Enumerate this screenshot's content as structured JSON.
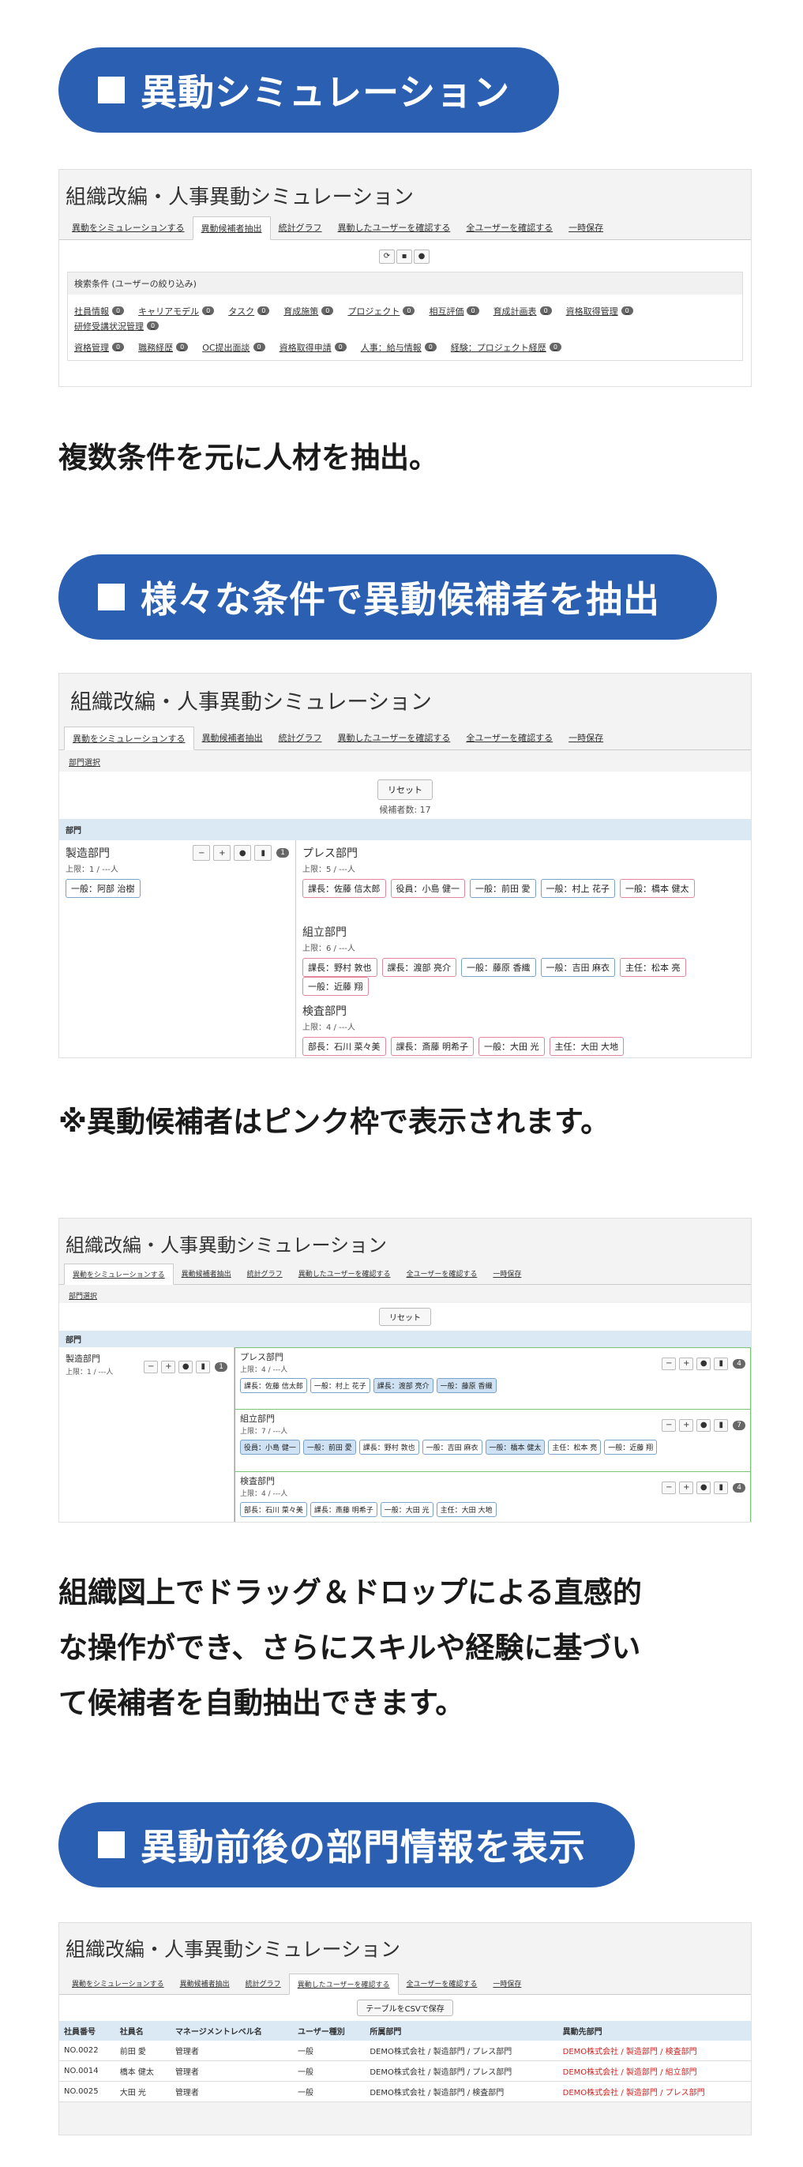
{
  "sections": {
    "s1_heading": "異動シミュレーション",
    "s1_text": "複数条件を元に人材を抽出。",
    "s2_heading": "様々な条件で異動候補者を抽出",
    "s2_text": "※異動候補者はピンク枠で表示されます。",
    "s3_text": [
      "組織図上でドラッグ＆ドロップによる直感的",
      "な操作ができ、さらにスキルや経験に基づい",
      "て候補者を自動抽出できます。"
    ],
    "s4_heading": "異動前後の部門情報を表示"
  },
  "app": {
    "title": "組織改編・人事異動シミュレーション",
    "tabs": [
      "異動をシミュレーションする",
      "異動候補者抽出",
      "統計グラフ",
      "異動したユーザーを確認する",
      "全ユーザーを確認する",
      "一時保存"
    ]
  },
  "shot1": {
    "icons": [
      "refresh-icon",
      "save-icon",
      "user-icon"
    ],
    "filter_title": "検索条件 (ユーザーの絞り込み)",
    "chips_row1": [
      {
        "label": "社員情報",
        "n": "0"
      },
      {
        "label": "キャリアモデル",
        "n": "0"
      },
      {
        "label": "タスク",
        "n": "0"
      },
      {
        "label": "育成施策",
        "n": "0"
      },
      {
        "label": "プロジェクト",
        "n": "0"
      },
      {
        "label": "相互評価",
        "n": "0"
      },
      {
        "label": "育成計画表",
        "n": "0"
      },
      {
        "label": "資格取得管理",
        "n": "0"
      },
      {
        "label": "研修受講状況管理",
        "n": "0"
      }
    ],
    "chips_row2": [
      {
        "label": "資格管理",
        "n": "0"
      },
      {
        "label": "職務経歴",
        "n": "0"
      },
      {
        "label": "OC提出面談",
        "n": "0"
      },
      {
        "label": "資格取得申請",
        "n": "0"
      },
      {
        "label": "人事：給与情報",
        "n": "0"
      },
      {
        "label": "経験：プロジェクト経歴",
        "n": "0"
      }
    ]
  },
  "shot2": {
    "sub_tab": "部門選択",
    "reset": "リセット",
    "candidates": "候補者数: 17",
    "section": "部門",
    "left_dept": {
      "name": "製造部門",
      "cap": "上限：1 / ---人",
      "count": "1",
      "members": [
        {
          "label": "一般：阿部 治樹",
          "pink": false
        }
      ]
    },
    "depts": [
      {
        "name": "プレス部門",
        "cap": "上限：5 / ---人",
        "members": [
          {
            "label": "課長：佐藤 信太郎",
            "pink": true
          },
          {
            "label": "役員：小島 健一",
            "pink": true
          },
          {
            "label": "一般：前田 愛",
            "pink": false
          },
          {
            "label": "一般：村上 花子",
            "pink": false
          },
          {
            "label": "一般：橋本 健太",
            "pink": true
          }
        ]
      },
      {
        "name": "組立部門",
        "cap": "上限：6 / ---人",
        "members": [
          {
            "label": "課長：野村 敦也",
            "pink": true
          },
          {
            "label": "課長：渡部 亮介",
            "pink": true
          },
          {
            "label": "一般：藤原 香織",
            "pink": false
          },
          {
            "label": "一般：吉田 麻衣",
            "pink": false
          },
          {
            "label": "主任：松本 亮",
            "pink": true
          },
          {
            "label": "一般：近藤 翔",
            "pink": true
          }
        ]
      },
      {
        "name": "検査部門",
        "cap": "上限：4 / ---人",
        "members": [
          {
            "label": "部長：石川 菜々美",
            "pink": true
          },
          {
            "label": "課長：斎藤 明希子",
            "pink": true
          },
          {
            "label": "一般：大田 光",
            "pink": true
          },
          {
            "label": "主任：大田 大地",
            "pink": true
          }
        ]
      }
    ]
  },
  "shot3": {
    "sub_tab": "部門選択",
    "reset": "リセット",
    "section": "部門",
    "left_dept": {
      "name": "製造部門",
      "cap": "上限：1 / ---人",
      "count": "1"
    },
    "depts": [
      {
        "name": "プレス部門",
        "cap": "上限：4 / ---人",
        "count": "4",
        "members": [
          {
            "label": "課長：佐藤 信太郎",
            "hl": false
          },
          {
            "label": "一般：村上 花子",
            "hl": false
          },
          {
            "label": "課長：渡部 亮介",
            "hl": true
          },
          {
            "label": "一般：藤原 香織",
            "hl": true
          }
        ]
      },
      {
        "name": "組立部門",
        "cap": "上限：7 / ---人",
        "count": "7",
        "members": [
          {
            "label": "役員：小島 健一",
            "hl": true
          },
          {
            "label": "一般：前田 愛",
            "hl": true
          },
          {
            "label": "課長：野村 敦也",
            "hl": false
          },
          {
            "label": "一般：吉田 麻衣",
            "hl": false
          },
          {
            "label": "一般：橋本 健太",
            "hl": true
          },
          {
            "label": "主任：松本 亮",
            "hl": false
          },
          {
            "label": "一般：近藤 翔",
            "hl": false
          }
        ]
      },
      {
        "name": "検査部門",
        "cap": "上限：4 / ---人",
        "count": "4",
        "members": [
          {
            "label": "部長：石川 菜々美",
            "hl": false
          },
          {
            "label": "課長：斎藤 明希子",
            "hl": false
          },
          {
            "label": "一般：大田 光",
            "hl": false
          },
          {
            "label": "主任：大田 大地",
            "hl": false
          }
        ]
      }
    ]
  },
  "shot4": {
    "csv_button": "テーブルをCSVで保存",
    "headers": [
      "社員番号",
      "社員名",
      "マネージメントレベル名",
      "ユーザー種別",
      "所属部門",
      "異動先部門"
    ],
    "rows": [
      [
        "NO.0022",
        "前田 愛",
        "管理者",
        "一般",
        "DEMO株式会社 / 製造部門 / プレス部門",
        "DEMO株式会社 / 製造部門 / 検査部門"
      ],
      [
        "NO.0014",
        "橋本 健太",
        "管理者",
        "一般",
        "DEMO株式会社 / 製造部門 / プレス部門",
        "DEMO株式会社 / 製造部門 / 組立部門"
      ],
      [
        "NO.0025",
        "大田 光",
        "管理者",
        "一般",
        "DEMO株式会社 / 製造部門 / 検査部門",
        "DEMO株式会社 / 製造部門 / プレス部門"
      ]
    ]
  },
  "colors": {
    "accent": "#2b5fb2",
    "pink_border": "#e2869d",
    "blue_border": "#7aa3cc",
    "red_text": "#d21f1f"
  }
}
